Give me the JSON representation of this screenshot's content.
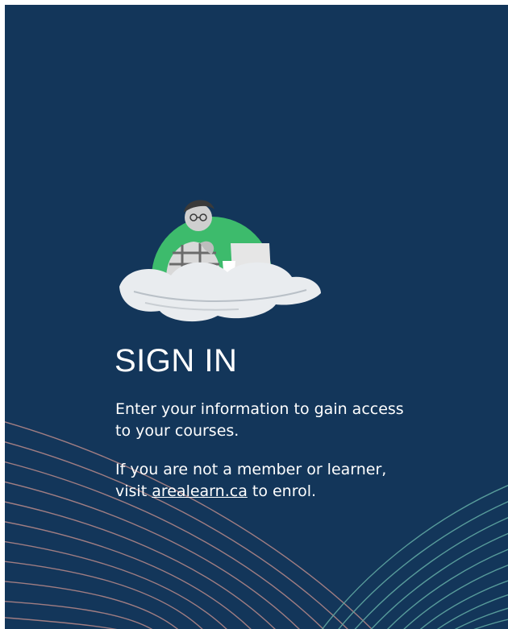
{
  "colors": {
    "background": "#13365a",
    "text": "#ffffff",
    "accent_green": "#3dbb6c",
    "decor_line_pink": "#b98a8a",
    "decor_line_teal": "#5fa7a2"
  },
  "hero": {
    "icon": "person-with-laptop-on-cloud-illustration"
  },
  "signin": {
    "title": "SIGN IN",
    "intro_line_1": "Enter your information to gain access",
    "intro_line_2": "to your courses.",
    "member_line_1": "If you are not a member or learner,",
    "member_prefix": "visit ",
    "member_link": "arealearn.ca",
    "member_suffix": " to enrol."
  }
}
